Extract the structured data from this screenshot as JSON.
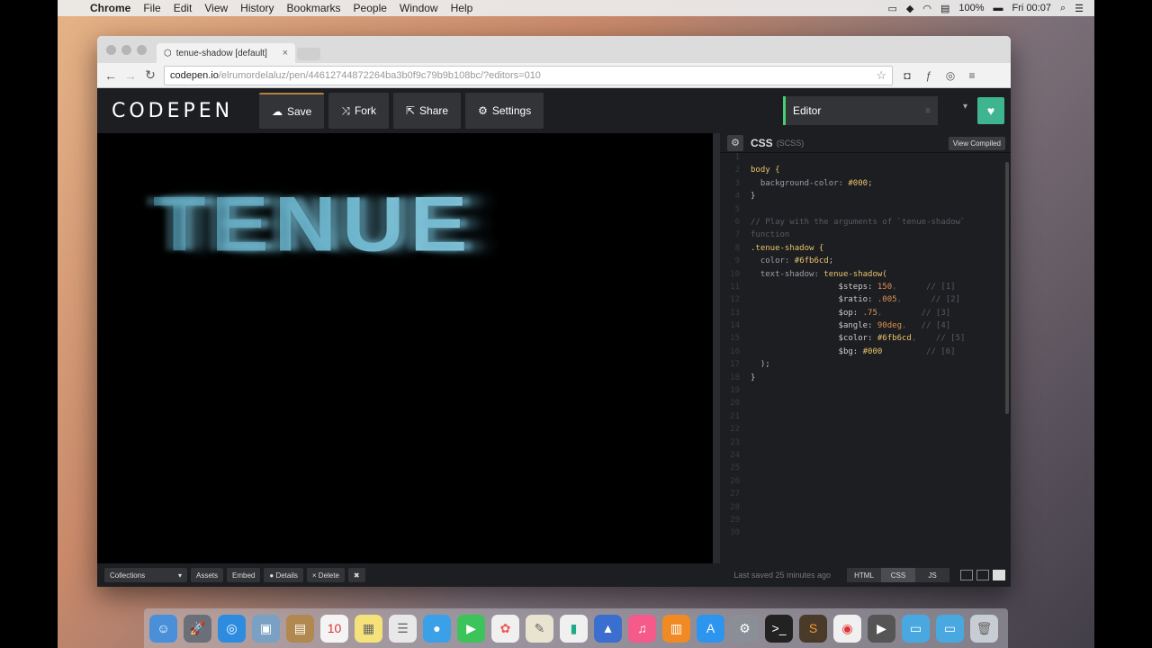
{
  "menubar": {
    "app": "Chrome",
    "items": [
      "File",
      "Edit",
      "View",
      "History",
      "Bookmarks",
      "People",
      "Window",
      "Help"
    ],
    "battery": "100%",
    "clock": "Fri 00:07"
  },
  "browser": {
    "tab_title": "tenue-shadow [default]",
    "url_domain": "codepen.io",
    "url_path": "/elrumordelaluz/pen/44612744872264ba3b0f9c79b9b108bc/?editors=010"
  },
  "codepen": {
    "logo": "CODEPEN",
    "buttons": {
      "save": "Save",
      "fork": "Fork",
      "share": "Share",
      "settings": "Settings"
    },
    "editor_select": "Editor"
  },
  "preview": {
    "text": "TENUE"
  },
  "css_pane": {
    "title": "CSS",
    "subtitle": "(SCSS)",
    "view_compiled": "View Compiled",
    "line_numbers": [
      "1",
      "2",
      "3",
      "4",
      "5",
      "6",
      "7",
      "8",
      "9",
      "10",
      "11",
      "12",
      "13",
      "14",
      "15",
      "16",
      "17",
      "18",
      "19",
      "20",
      "21",
      "22",
      "23",
      "24",
      "25",
      "26",
      "27",
      "28",
      "29",
      "30"
    ],
    "code": {
      "l1": "body {",
      "l2a": "  background-color: ",
      "l2b": "#000",
      "l3": "}",
      "l5": "// Play with the arguments of `tenue-shadow`",
      "l6": "function",
      "l7": ".tenue-shadow {",
      "l8a": "  color: ",
      "l8b": "#6fb6cd",
      "l9a": "  text-shadow: ",
      "l9b": "tenue-shadow(",
      "l10a": "                  $steps: ",
      "l10b": "150",
      "l10c": ",      // [1]",
      "l11a": "                  $ratio: ",
      "l11b": ".005",
      "l11c": ",      // [2]",
      "l12a": "                  $op: ",
      "l12b": ".75",
      "l12c": ",        // [3]",
      "l13a": "                  $angle: ",
      "l13b": "90deg",
      "l13c": ",   // [4]",
      "l14a": "                  $color: ",
      "l14b": "#6fb6cd",
      "l14c": ",    // [5]",
      "l15a": "                  $bg: ",
      "l15b": "#000",
      "l15c": "         // [6]",
      "l16": "  );",
      "l17": "}"
    }
  },
  "footer": {
    "collections": "Collections",
    "assets": "Assets",
    "embed": "Embed",
    "details": "Details",
    "delete": "Delete",
    "last_saved": "Last saved 25 minutes ago",
    "tabs": [
      "HTML",
      "CSS",
      "JS"
    ]
  }
}
